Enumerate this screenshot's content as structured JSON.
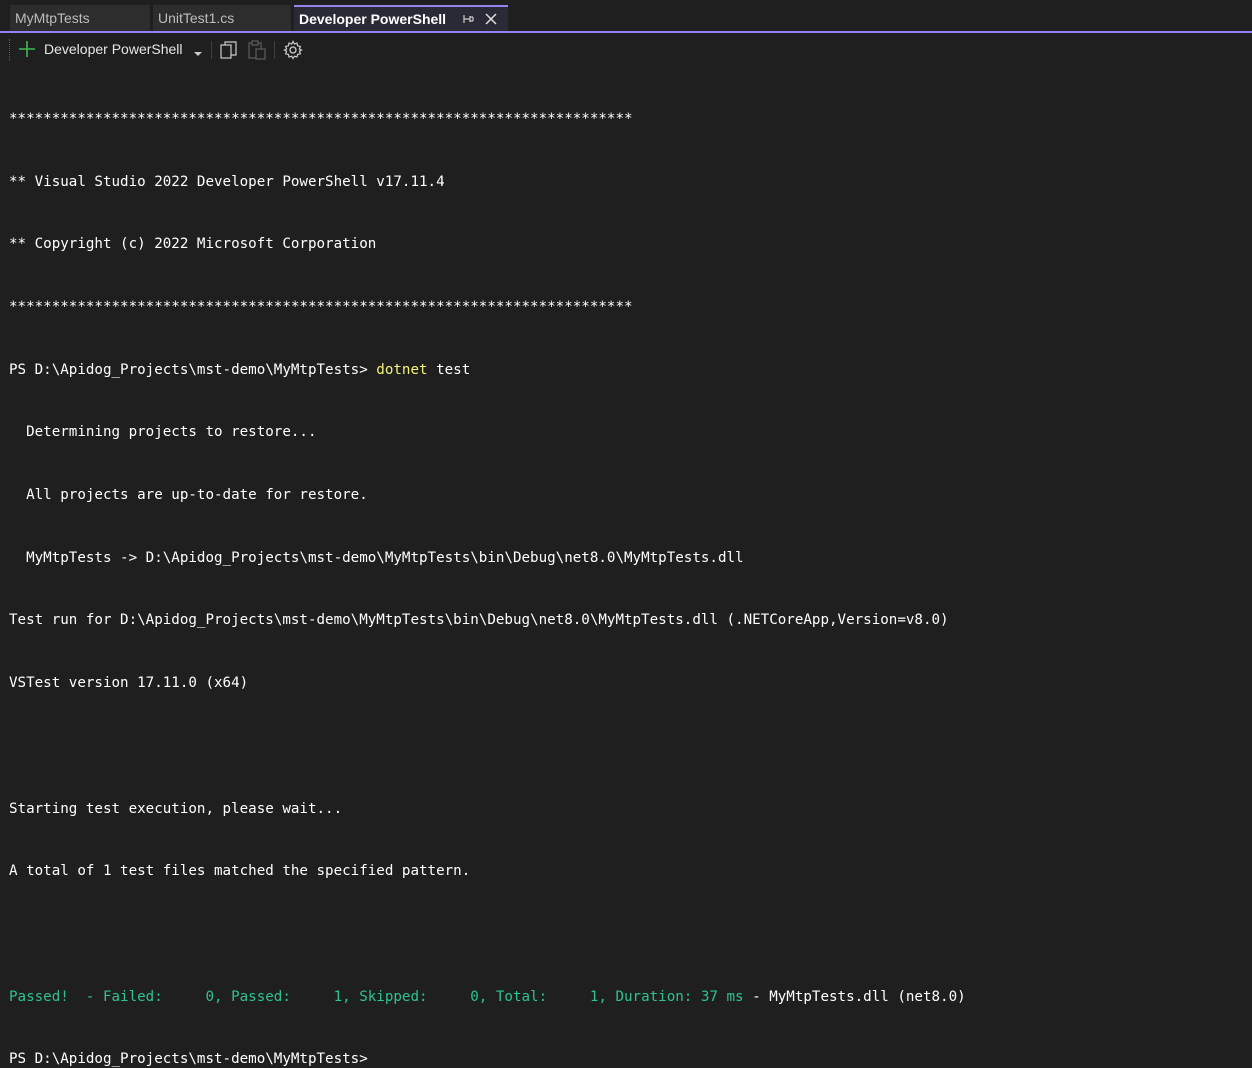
{
  "tabs": [
    {
      "label": "MyMtpTests"
    },
    {
      "label": "UnitTest1.cs"
    },
    {
      "label": "Developer PowerShell"
    }
  ],
  "toolbar": {
    "new_terminal_label": "Developer PowerShell"
  },
  "terminal": {
    "stars": "*************************************************************************",
    "banner1": "** Visual Studio 2022 Developer PowerShell v17.11.4",
    "banner2": "** Copyright (c) 2022 Microsoft Corporation",
    "prompt1": "PS D:\\Apidog_Projects\\mst-demo\\MyMtpTests> ",
    "cmd_dotnet": "dotnet",
    "cmd_rest": " test",
    "out1": "  Determining projects to restore...",
    "out2": "  All projects are up-to-date for restore.",
    "out3": "  MyMtpTests -> D:\\Apidog_Projects\\mst-demo\\MyMtpTests\\bin\\Debug\\net8.0\\MyMtpTests.dll",
    "out4": "Test run for D:\\Apidog_Projects\\mst-demo\\MyMtpTests\\bin\\Debug\\net8.0\\MyMtpTests.dll (.NETCoreApp,Version=v8.0)",
    "out5": "VSTest version 17.11.0 (x64)",
    "out6": "Starting test execution, please wait...",
    "out7": "A total of 1 test files matched the specified pattern.",
    "result_green": "Passed!  - Failed:     0, Passed:     1, Skipped:     0, Total:     1, Duration: 37 ms",
    "result_rest": " - MyMtpTests.dll (net8.0)",
    "prompt2": "PS D:\\Apidog_Projects\\mst-demo\\MyMtpTests>"
  },
  "colors": {
    "accent": "#9184ee",
    "background": "#1f1f1f",
    "command": "#f3f37c",
    "success": "#2ec38f",
    "add_icon": "#3fb950"
  },
  "icons": [
    "pin-icon",
    "close-icon",
    "plus-icon",
    "chevron-down-icon",
    "copy-icon",
    "paste-icon",
    "gear-icon"
  ]
}
